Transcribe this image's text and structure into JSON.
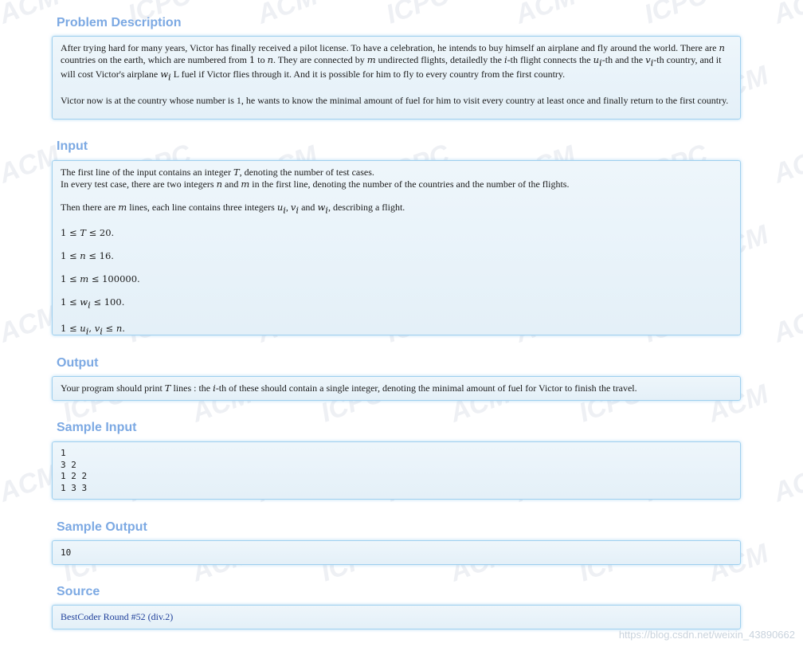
{
  "sections": {
    "problem_description": {
      "title": "Problem Description",
      "p1": {
        "t1": "After trying hard for many years, Victor has finally received a pilot license. To have a celebration, he intends to buy himself an airplane and fly around the world. There are ",
        "m1": "n",
        "t2": " countries on the earth, which are numbered from ",
        "m2": "1",
        "t3": " to ",
        "m3": "n",
        "t4": ". They are connected by ",
        "m4": "m",
        "t5": " undirected flights, detailedly the ",
        "m5": "i",
        "t6": "-th flight connects the ",
        "m6": "u",
        "s6": "i",
        "t7": "-th and the ",
        "m7": "v",
        "s7": "i",
        "t8": "-th country, and it will cost Victor's airplane ",
        "m8": "w",
        "s8": "i",
        "t9": " L fuel if Victor flies through it. And it is possible for him to fly to every country from the first country."
      },
      "p2": "Victor now is at the country whose number is 1, he wants to know the minimal amount of fuel for him to visit every country at least once and finally return to the first country."
    },
    "input": {
      "title": "Input",
      "p1": {
        "t1": "The first line of the input contains an integer ",
        "m1": "T",
        "t2": ", denoting the number of test cases.",
        "t3": "In every test case, there are two integers ",
        "m2": "n",
        "t4": " and ",
        "m3": "m",
        "t5": " in the first line, denoting the number of the countries and the number of the flights."
      },
      "p2": {
        "t1": "Then there are ",
        "m1": "m",
        "t2": " lines, each line contains three integers ",
        "m2": "u",
        "s2": "i",
        "t3": ", ",
        "m3": "v",
        "s3": "i",
        "t4": " and ",
        "m4": "w",
        "s4": "i",
        "t5": ", describing a flight."
      },
      "c1": {
        "a": "1 ≤ ",
        "v": "T",
        "b": " ≤ 20."
      },
      "c2": {
        "a": "1 ≤ ",
        "v": "n",
        "b": " ≤ 16."
      },
      "c3": {
        "a": "1 ≤ ",
        "v": "m",
        "b": " ≤ 100000."
      },
      "c4": {
        "a": "1 ≤ ",
        "v": "w",
        "s": "i",
        "b": " ≤ 100."
      },
      "c5": {
        "a": "1 ≤ ",
        "v1": "u",
        "s1": "i",
        "mid": ", ",
        "v2": "v",
        "s2": "i",
        "b": " ≤ ",
        "v3": "n",
        "c": "."
      }
    },
    "output": {
      "title": "Output",
      "t1": "Your program should print ",
      "m1": "T",
      "t2": " lines : the ",
      "m2": "i",
      "t3": "-th of these should contain a single integer, denoting the minimal amount of fuel for Victor to finish the travel."
    },
    "sample_input": {
      "title": "Sample Input",
      "text": "1\n3 2\n1 2 2\n1 3 3"
    },
    "sample_output": {
      "title": "Sample Output",
      "text": "10"
    },
    "source": {
      "title": "Source",
      "link": "BestCoder Round #52 (div.2)"
    }
  },
  "footer_url": "https://blog.csdn.net/weixin_43890662",
  "colors": {
    "title": "#7ca9e3",
    "panel_border": "#9fd0ef",
    "panel_bg": "#e8f2f9",
    "link": "#1f3f9a",
    "text": "#1a1a1a"
  }
}
